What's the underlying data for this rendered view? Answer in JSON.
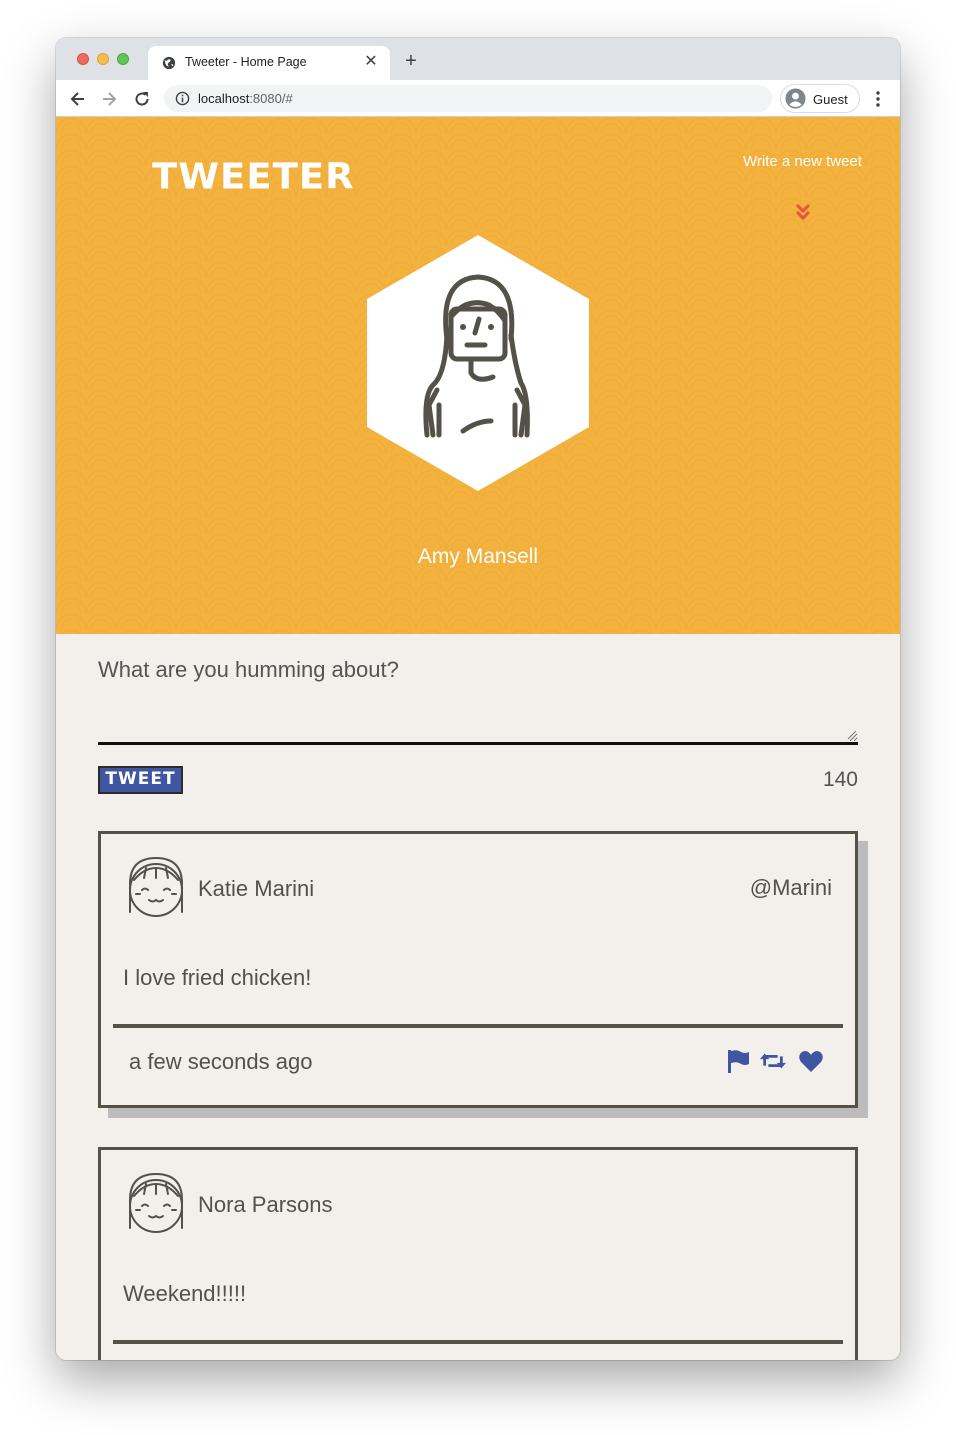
{
  "browser": {
    "tab_title": "Tweeter - Home Page",
    "url_host": "localhost",
    "url_rest": ":8080/#",
    "profile_label": "Guest"
  },
  "header": {
    "logo": "TWEETER",
    "write_link": "Write a new tweet",
    "profile_name": "Amy Mansell"
  },
  "compose": {
    "placeholder": "What are you humming about?",
    "button_label": "TWEET",
    "counter": "140"
  },
  "tweets": [
    {
      "name": "Katie Marini",
      "handle": "@Marini",
      "content": "I love fried chicken!",
      "time": "a few seconds ago"
    },
    {
      "name": "Nora Parsons",
      "content": "Weekend!!!!!"
    }
  ],
  "colors": {
    "header_bg": "#f3b13e",
    "accent_blue": "#4056a1",
    "chevron_red": "#e8543f",
    "text_dark": "#545149",
    "page_bg": "#f3f0eb"
  },
  "icons": [
    "globe-icon",
    "close-icon",
    "plus-icon",
    "back-icon",
    "forward-icon",
    "reload-icon",
    "info-icon",
    "profile-avatar-icon",
    "kebab-menu-icon",
    "double-chevron-down-icon",
    "user-avatar-icon",
    "flag-icon",
    "retweet-icon",
    "heart-icon"
  ]
}
